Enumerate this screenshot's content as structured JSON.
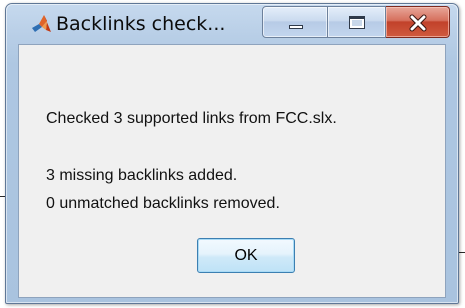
{
  "window": {
    "title": "Backlinks check...",
    "app_icon": "matlab-logo-icon",
    "caption_buttons": {
      "minimize_icon": "minimize-icon",
      "maximize_icon": "maximize-icon",
      "close_icon": "close-icon"
    }
  },
  "dialog": {
    "message_line_1": "Checked 3 supported links from FCC.slx.",
    "message_line_2": "3 missing backlinks added.",
    "message_line_3": "0 unmatched backlinks removed.",
    "ok_label": "OK"
  },
  "colors": {
    "frame": "#aec7e2",
    "close_button": "#c2412a",
    "client_bg": "#f0f0f0",
    "ok_button_border": "#3c7fb1"
  }
}
